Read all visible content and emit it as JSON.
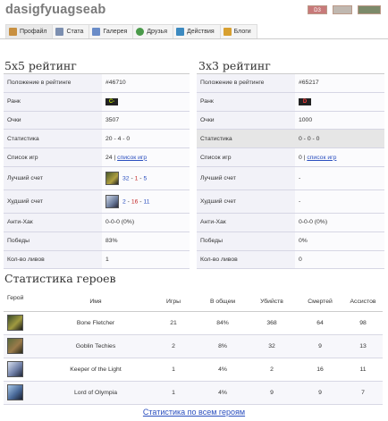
{
  "header": {
    "username": "dasigfyuagseab",
    "badges": [
      "D3",
      "",
      ""
    ]
  },
  "tabs": [
    {
      "label": "Профайл",
      "icon": "profile-icon",
      "color": "#c89040"
    },
    {
      "label": "Стата",
      "icon": "stats-icon",
      "color": "#7c8fb0"
    },
    {
      "label": "Галерея",
      "icon": "gallery-icon",
      "color": "#6a8cc8"
    },
    {
      "label": "Друзья",
      "icon": "friends-icon",
      "color": "#4a9a4a"
    },
    {
      "label": "Действия",
      "icon": "actions-icon",
      "color": "#3c8ac0"
    },
    {
      "label": "Блоги",
      "icon": "blogs-icon",
      "color": "#d8a030"
    }
  ],
  "rating5x5": {
    "title": "5x5 рейтинг",
    "rows": {
      "position": {
        "label": "Положение в рейтинге",
        "value": "#46710"
      },
      "rank": {
        "label": "Ранк",
        "value": "C-"
      },
      "points": {
        "label": "Очки",
        "value": "3507"
      },
      "statistics": {
        "label": "Статистика",
        "value": "20 - 4 - 0"
      },
      "games": {
        "label": "Список игр",
        "count": "24",
        "sep": " | ",
        "link": "список игр"
      },
      "best": {
        "label": "Лучший счет",
        "k": "32",
        "d": "1",
        "a": "5"
      },
      "worst": {
        "label": "Худший счет",
        "k": "2",
        "d": "16",
        "a": "11"
      },
      "antihack": {
        "label": "Анти-Хак",
        "value": "0-0-0 (0%)"
      },
      "wins": {
        "label": "Победы",
        "value": "83%"
      },
      "leaves": {
        "label": "Кол-во ливов",
        "value": "1"
      }
    }
  },
  "rating3x3": {
    "title": "3x3 рейтинг",
    "rows": {
      "position": {
        "label": "Положение в рейтинге",
        "value": "#65217"
      },
      "rank": {
        "label": "Ранк",
        "value": "D"
      },
      "points": {
        "label": "Очки",
        "value": "1000"
      },
      "statistics": {
        "label": "Статистика",
        "value": "0 - 0 - 0"
      },
      "games": {
        "label": "Список игр",
        "count": "0",
        "sep": " | ",
        "link": "список игр"
      },
      "best": {
        "label": "Лучший счет",
        "value": "-"
      },
      "worst": {
        "label": "Худший счет",
        "value": "-"
      },
      "antihack": {
        "label": "Анти-Хак",
        "value": "0-0-0 (0%)"
      },
      "wins": {
        "label": "Победы",
        "value": "0%"
      },
      "leaves": {
        "label": "Кол-во ливов",
        "value": "0"
      }
    }
  },
  "heroes": {
    "title": "Статистика героев",
    "columns": [
      "Герой",
      "Имя",
      "Игры",
      "В общем",
      "Убийств",
      "Смертей",
      "Ассистов"
    ],
    "rows": [
      {
        "name": "Bone Fletcher",
        "games": "21",
        "total": "84%",
        "kills": "368",
        "deaths": "64",
        "assists": "98"
      },
      {
        "name": "Goblin Techies",
        "games": "2",
        "total": "8%",
        "kills": "32",
        "deaths": "9",
        "assists": "13"
      },
      {
        "name": "Keeper of the Light",
        "games": "1",
        "total": "4%",
        "kills": "2",
        "deaths": "16",
        "assists": "11"
      },
      {
        "name": "Lord of Olympia",
        "games": "1",
        "total": "4%",
        "kills": "9",
        "deaths": "9",
        "assists": "7"
      }
    ],
    "all_link": "Статистика по всем героям"
  },
  "colors": {
    "link": "#2b4fbf",
    "deaths_red": "#c42c2c",
    "row_label_bg": "#f2f2f8",
    "rank_c": "#b8e000",
    "rank_d": "#ff3b3b"
  }
}
